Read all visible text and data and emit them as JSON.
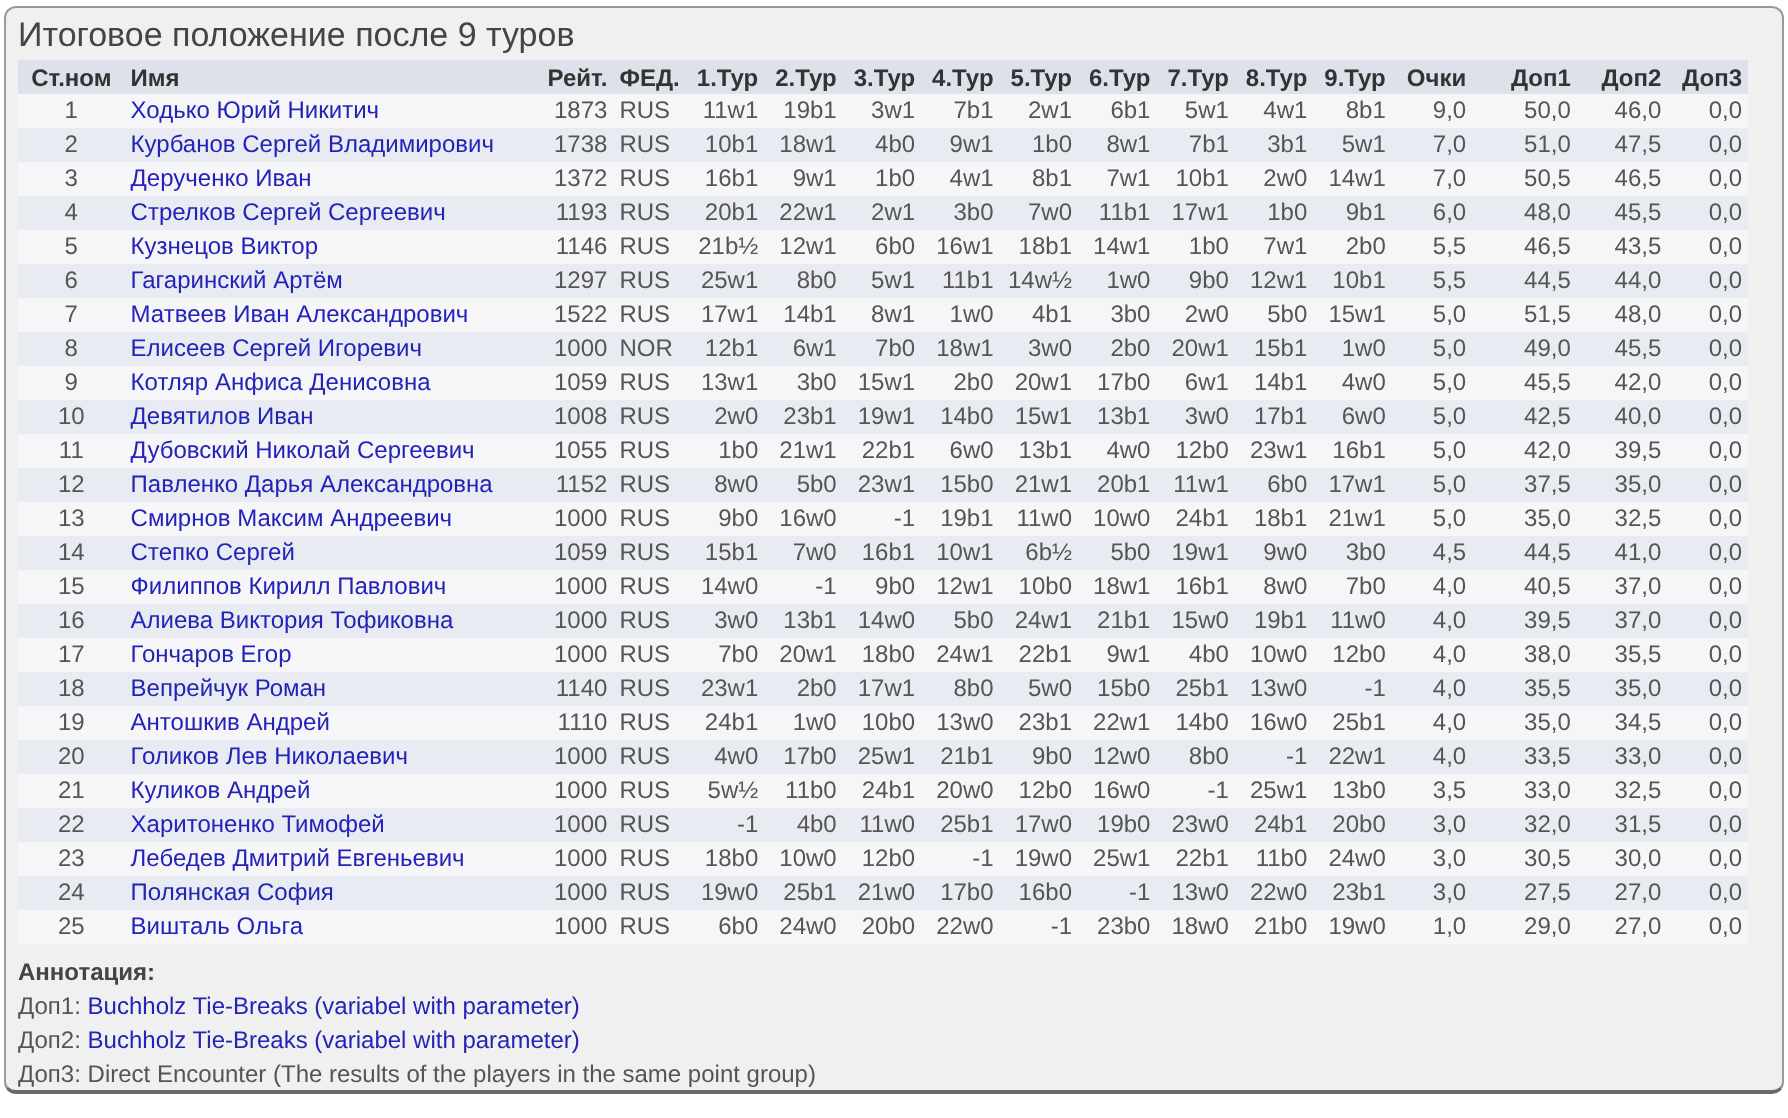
{
  "title": "Итоговое положение после 9 туров",
  "table": {
    "columns": [
      "Ст.ном",
      "Имя",
      "Рейт.",
      "ФЕД.",
      "1.Тур",
      "2.Тур",
      "3.Тур",
      "4.Тур",
      "5.Тур",
      "6.Тур",
      "7.Тур",
      "8.Тур",
      "9.Тур",
      "Очки",
      "Доп1",
      "Доп2",
      "Доп3"
    ],
    "rows": [
      [
        "1",
        "Ходько Юрий Никитич",
        "1873",
        "RUS",
        "11w1",
        "19b1",
        "3w1",
        "7b1",
        "2w1",
        "6b1",
        "5w1",
        "4w1",
        "8b1",
        "9,0",
        "50,0",
        "46,0",
        "0,0"
      ],
      [
        "2",
        "Курбанов Сергей Владимирович",
        "1738",
        "RUS",
        "10b1",
        "18w1",
        "4b0",
        "9w1",
        "1b0",
        "8w1",
        "7b1",
        "3b1",
        "5w1",
        "7,0",
        "51,0",
        "47,5",
        "0,0"
      ],
      [
        "3",
        "Дерученко Иван",
        "1372",
        "RUS",
        "16b1",
        "9w1",
        "1b0",
        "4w1",
        "8b1",
        "7w1",
        "10b1",
        "2w0",
        "14w1",
        "7,0",
        "50,5",
        "46,5",
        "0,0"
      ],
      [
        "4",
        "Стрелков Сергей Сергеевич",
        "1193",
        "RUS",
        "20b1",
        "22w1",
        "2w1",
        "3b0",
        "7w0",
        "11b1",
        "17w1",
        "1b0",
        "9b1",
        "6,0",
        "48,0",
        "45,5",
        "0,0"
      ],
      [
        "5",
        "Кузнецов Виктор",
        "1146",
        "RUS",
        "21b½",
        "12w1",
        "6b0",
        "16w1",
        "18b1",
        "14w1",
        "1b0",
        "7w1",
        "2b0",
        "5,5",
        "46,5",
        "43,5",
        "0,0"
      ],
      [
        "6",
        "Гагаринский Артём",
        "1297",
        "RUS",
        "25w1",
        "8b0",
        "5w1",
        "11b1",
        "14w½",
        "1w0",
        "9b0",
        "12w1",
        "10b1",
        "5,5",
        "44,5",
        "44,0",
        "0,0"
      ],
      [
        "7",
        "Матвеев Иван Александрович",
        "1522",
        "RUS",
        "17w1",
        "14b1",
        "8w1",
        "1w0",
        "4b1",
        "3b0",
        "2w0",
        "5b0",
        "15w1",
        "5,0",
        "51,5",
        "48,0",
        "0,0"
      ],
      [
        "8",
        "Елисеев Сергей Игоревич",
        "1000",
        "NOR",
        "12b1",
        "6w1",
        "7b0",
        "18w1",
        "3w0",
        "2b0",
        "20w1",
        "15b1",
        "1w0",
        "5,0",
        "49,0",
        "45,5",
        "0,0"
      ],
      [
        "9",
        "Котляр Анфиса Денисовна",
        "1059",
        "RUS",
        "13w1",
        "3b0",
        "15w1",
        "2b0",
        "20w1",
        "17b0",
        "6w1",
        "14b1",
        "4w0",
        "5,0",
        "45,5",
        "42,0",
        "0,0"
      ],
      [
        "10",
        "Девятилов Иван",
        "1008",
        "RUS",
        "2w0",
        "23b1",
        "19w1",
        "14b0",
        "15w1",
        "13b1",
        "3w0",
        "17b1",
        "6w0",
        "5,0",
        "42,5",
        "40,0",
        "0,0"
      ],
      [
        "11",
        "Дубовский Николай Сергеевич",
        "1055",
        "RUS",
        "1b0",
        "21w1",
        "22b1",
        "6w0",
        "13b1",
        "4w0",
        "12b0",
        "23w1",
        "16b1",
        "5,0",
        "42,0",
        "39,5",
        "0,0"
      ],
      [
        "12",
        "Павленко Дарья Александровна",
        "1152",
        "RUS",
        "8w0",
        "5b0",
        "23w1",
        "15b0",
        "21w1",
        "20b1",
        "11w1",
        "6b0",
        "17w1",
        "5,0",
        "37,5",
        "35,0",
        "0,0"
      ],
      [
        "13",
        "Смирнов Максим Андреевич",
        "1000",
        "RUS",
        "9b0",
        "16w0",
        "-1",
        "19b1",
        "11w0",
        "10w0",
        "24b1",
        "18b1",
        "21w1",
        "5,0",
        "35,0",
        "32,5",
        "0,0"
      ],
      [
        "14",
        "Степко Сергей",
        "1059",
        "RUS",
        "15b1",
        "7w0",
        "16b1",
        "10w1",
        "6b½",
        "5b0",
        "19w1",
        "9w0",
        "3b0",
        "4,5",
        "44,5",
        "41,0",
        "0,0"
      ],
      [
        "15",
        "Филиппов Кирилл Павлович",
        "1000",
        "RUS",
        "14w0",
        "-1",
        "9b0",
        "12w1",
        "10b0",
        "18w1",
        "16b1",
        "8w0",
        "7b0",
        "4,0",
        "40,5",
        "37,0",
        "0,0"
      ],
      [
        "16",
        "Алиева Виктория Тофиковна",
        "1000",
        "RUS",
        "3w0",
        "13b1",
        "14w0",
        "5b0",
        "24w1",
        "21b1",
        "15w0",
        "19b1",
        "11w0",
        "4,0",
        "39,5",
        "37,0",
        "0,0"
      ],
      [
        "17",
        "Гончаров Егор",
        "1000",
        "RUS",
        "7b0",
        "20w1",
        "18b0",
        "24w1",
        "22b1",
        "9w1",
        "4b0",
        "10w0",
        "12b0",
        "4,0",
        "38,0",
        "35,5",
        "0,0"
      ],
      [
        "18",
        "Вепрейчук Роман",
        "1140",
        "RUS",
        "23w1",
        "2b0",
        "17w1",
        "8b0",
        "5w0",
        "15b0",
        "25b1",
        "13w0",
        "-1",
        "4,0",
        "35,5",
        "35,0",
        "0,0"
      ],
      [
        "19",
        "Антошкив Андрей",
        "1110",
        "RUS",
        "24b1",
        "1w0",
        "10b0",
        "13w0",
        "23b1",
        "22w1",
        "14b0",
        "16w0",
        "25b1",
        "4,0",
        "35,0",
        "34,5",
        "0,0"
      ],
      [
        "20",
        "Голиков Лев Николаевич",
        "1000",
        "RUS",
        "4w0",
        "17b0",
        "25w1",
        "21b1",
        "9b0",
        "12w0",
        "8b0",
        "-1",
        "22w1",
        "4,0",
        "33,5",
        "33,0",
        "0,0"
      ],
      [
        "21",
        "Куликов Андрей",
        "1000",
        "RUS",
        "5w½",
        "11b0",
        "24b1",
        "20w0",
        "12b0",
        "16w0",
        "-1",
        "25w1",
        "13b0",
        "3,5",
        "33,0",
        "32,5",
        "0,0"
      ],
      [
        "22",
        "Харитоненко Тимофей",
        "1000",
        "RUS",
        "-1",
        "4b0",
        "11w0",
        "25b1",
        "17w0",
        "19b0",
        "23w0",
        "24b1",
        "20b0",
        "3,0",
        "32,0",
        "31,5",
        "0,0"
      ],
      [
        "23",
        "Лебедев Дмитрий Евгеньевич",
        "1000",
        "RUS",
        "18b0",
        "10w0",
        "12b0",
        "-1",
        "19w0",
        "25w1",
        "22b1",
        "11b0",
        "24w0",
        "3,0",
        "30,5",
        "30,0",
        "0,0"
      ],
      [
        "24",
        "Полянская София",
        "1000",
        "RUS",
        "19w0",
        "25b1",
        "21w0",
        "17b0",
        "16b0",
        "-1",
        "13w0",
        "22w0",
        "23b1",
        "3,0",
        "27,5",
        "27,0",
        "0,0"
      ],
      [
        "25",
        "Вишталь Ольга",
        "1000",
        "RUS",
        "6b0",
        "24w0",
        "20b0",
        "22w0",
        "-1",
        "23b0",
        "18w0",
        "21b0",
        "19w0",
        "1,0",
        "29,0",
        "27,0",
        "0,0"
      ]
    ]
  },
  "annotation": {
    "heading": "Аннотация:",
    "lines": [
      {
        "kind": "link",
        "label": "Доп1:",
        "text": "Buchholz Tie-Breaks (variabel with parameter)"
      },
      {
        "kind": "link",
        "label": "Доп2:",
        "text": "Buchholz Tie-Breaks (variabel with parameter)"
      },
      {
        "kind": "text",
        "label": "Доп3:",
        "text": "Direct Encounter (The results of the players in the same point group)"
      }
    ]
  }
}
